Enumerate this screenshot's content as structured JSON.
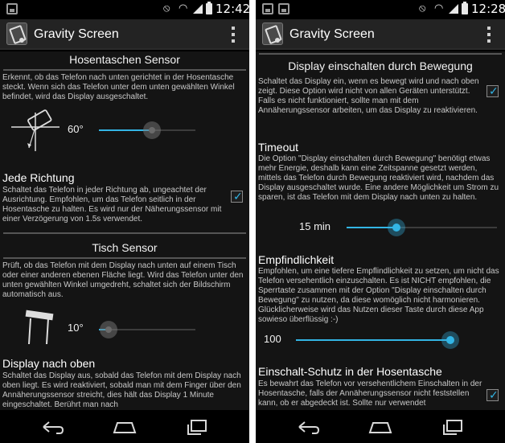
{
  "app": {
    "title": "Gravity Screen",
    "accent_color": "#33b5e5"
  },
  "screens": [
    {
      "status_time": "12:42",
      "status_icons": [
        "notification-icon",
        "vibrate-off-icon",
        "wifi-icon",
        "signal-icon",
        "battery-icon"
      ],
      "sections": {
        "pocket": {
          "title": "Hosentaschen Sensor",
          "description": "Erkennt, ob das Telefon nach unten gerichtet in der Hosentasche steckt. Wenn sich das Telefon unter dem unten gewählten Winkel befindet, wird das Display ausgeschaltet.",
          "slider_label": "60°",
          "slider_value_fraction": 0.55
        },
        "any_direction": {
          "title": "Jede Richtung",
          "description": "Schaltet das Telefon in jeder Richtung ab, ungeachtet der Ausrichtung. Empfohlen, um das Telefon seitlich in der Hosentasche zu halten. Es wird nur der Näherungssensor mit einer Verzögerung von 1.5s verwendet.",
          "checked": true
        },
        "table": {
          "title": "Tisch Sensor",
          "description": "Prüft, ob das Telefon mit dem Display nach unten auf einem Tisch oder einer anderen ebenen Fläche liegt. Wird das Telefon unter den unten gewählten Winkel umgedreht, schaltet sich der Bildschirm automatisch aus.",
          "slider_label": "10°",
          "slider_value_fraction": 0.1
        },
        "display_up": {
          "title": "Display nach oben",
          "description": "Schaltet das Display aus, sobald das Telefon mit dem Display nach oben liegt. Es wird reaktiviert, sobald man mit dem Finger über den Annäherungssensor streicht, dies hält das Display 1 Minute eingeschaltet. Berührt man nach"
        }
      }
    },
    {
      "status_time": "12:28",
      "status_icons": [
        "notification-icon",
        "camera-icon",
        "vibrate-off-icon",
        "wifi-icon",
        "signal-icon",
        "battery-icon"
      ],
      "sections": {
        "motion": {
          "title": "Display einschalten durch Bewegung",
          "description": "Schaltet das Display ein, wenn es bewegt wird und nach oben zeigt. Diese Option wird nicht von allen Geräten unterstützt. Falls es nicht funktioniert, sollte man mit dem Annäherungssensor arbeiten, um das Display zu reaktivieren.",
          "checked": true
        },
        "timeout": {
          "title": "Timeout",
          "description": "Die Option \"Display einschalten durch Bewegung\" benötigt etwas mehr Energie, deshalb kann eine Zeitspanne gesetzt werden, mittels das Telefon durch Bewegung reaktiviert wird, nachdem das Display ausgeschaltet wurde. Eine andere Möglichkeit um Strom zu sparen, ist das Telefon mit dem Display nach unten zu halten.",
          "slider_label": "15 min",
          "slider_value_fraction": 0.33
        },
        "sensitivity": {
          "title": "Empfindlichkeit",
          "description": "Empfohlen, um eine tiefere Empflindlichkeit zu setzen, um nicht das Telefon versehentlich einzuschalten. Es ist NICHT empfohlen, die Sperrtaste zusammen mit der Option \"Display einschalten durch Bewegung\" zu nutzen, da diese womöglich nicht harmonieren. Glücklicherweise wird das Nutzen dieser Taste durch diese App sowieso überflüssig :-)",
          "slider_label": "100",
          "slider_value_fraction": 1.0
        },
        "pocket_protect": {
          "title": "Einschalt-Schutz in der Hosentasche",
          "description": "Es bewahrt das Telefon vor versehentlichem Einschalten in der Hosentasche, falls der Annäherungssensor nicht feststellen kann, ob er abgedeckt ist. Sollte nur verwendet",
          "checked": true
        }
      }
    }
  ],
  "nav_icons": [
    "back-icon",
    "home-icon",
    "recents-icon"
  ]
}
